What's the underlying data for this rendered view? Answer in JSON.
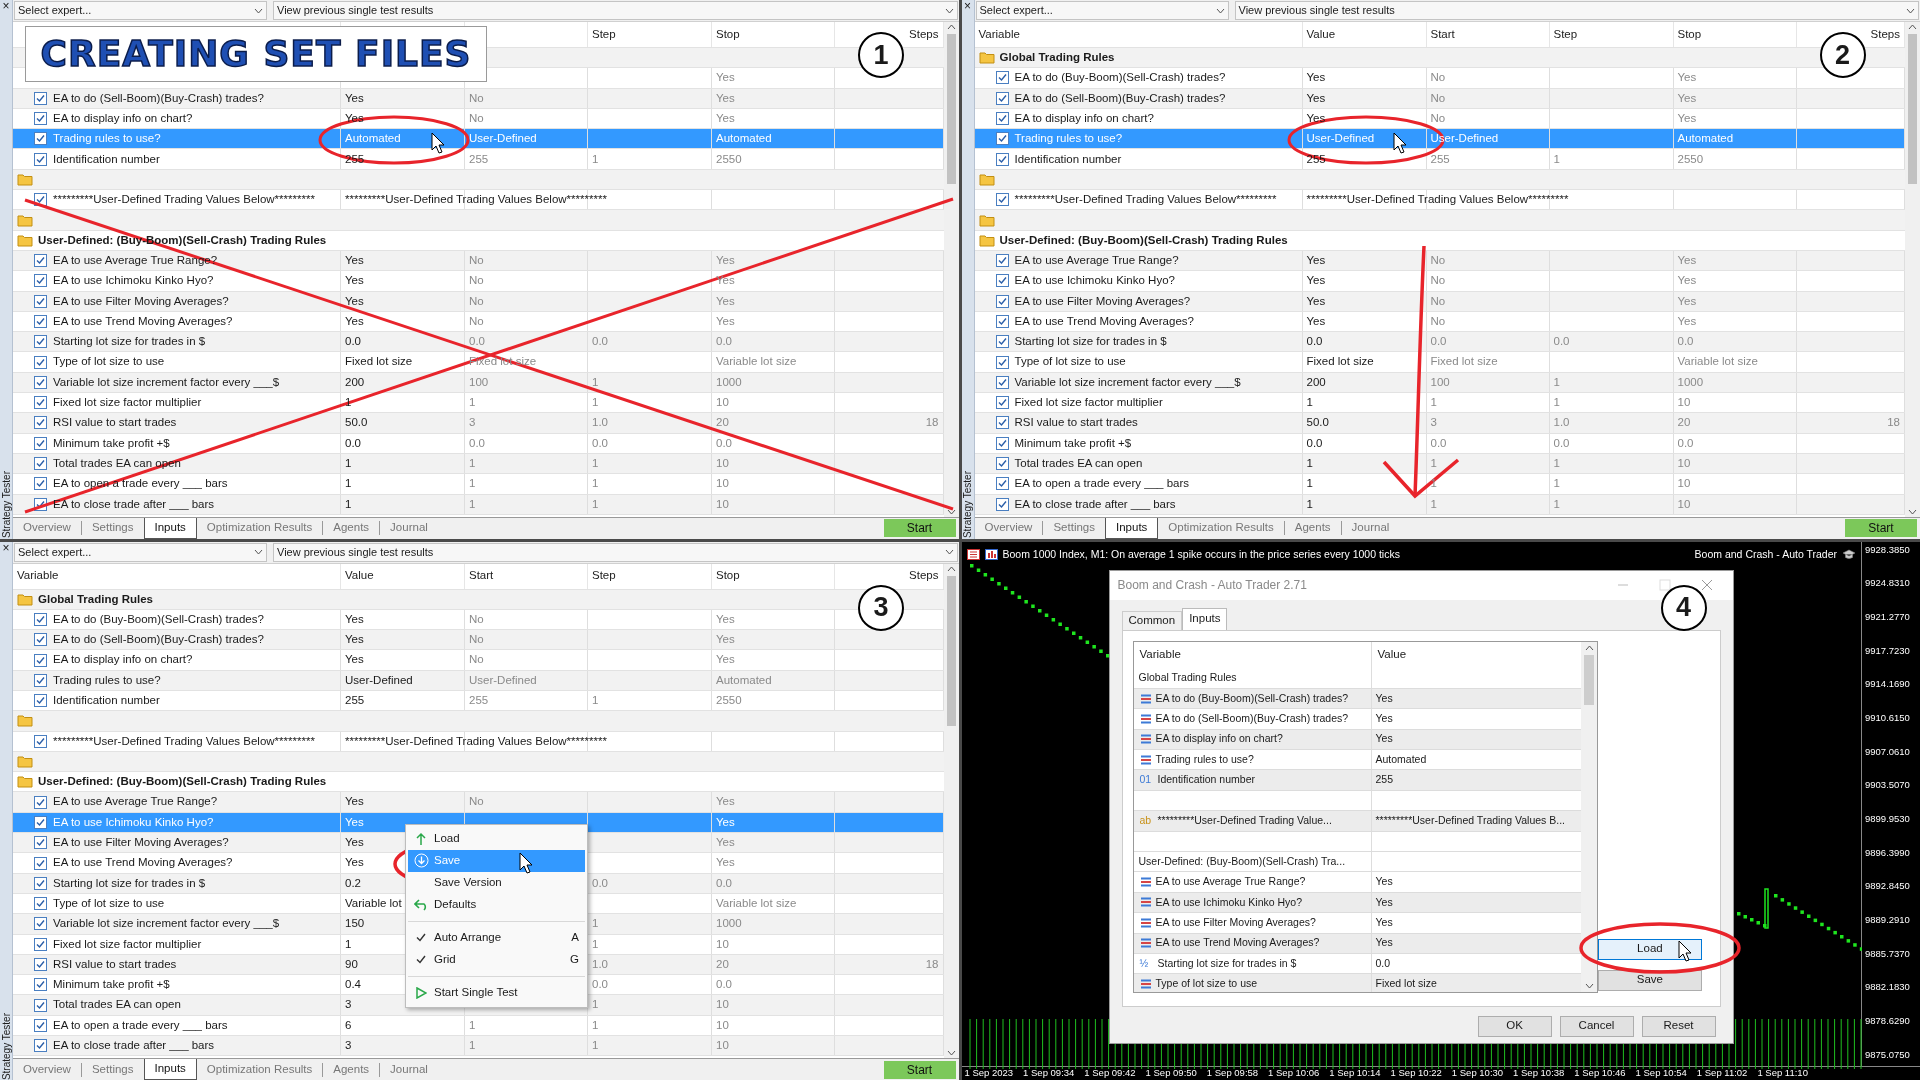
{
  "testers": [
    {
      "badge": "1",
      "banner": "CREATING SET FILES",
      "side": {
        "close": "×",
        "label": "Strategy Tester"
      },
      "toolbar": {
        "expert": "Select expert...",
        "results": "View previous single test results"
      },
      "header": {
        "step": "Step",
        "stop": "Stop",
        "steps": "Steps"
      },
      "rows": [
        {
          "kind": "group"
        },
        {
          "kind": "param",
          "selected": false,
          "stop": "Yes"
        },
        {
          "kind": "param",
          "checked": true,
          "selected": false,
          "variable": "EA to do (Sell-Boom)(Buy-Crash) trades?",
          "value": "Yes",
          "start": "No",
          "stop": "Yes"
        },
        {
          "kind": "param",
          "checked": true,
          "selected": false,
          "variable": "EA to display info on chart?",
          "value": "Yes",
          "start": "No",
          "stop": "Yes"
        },
        {
          "kind": "param",
          "checked": true,
          "selected": true,
          "variable": "Trading rules to use?",
          "value": "Automated",
          "start": "User-Defined",
          "stop": "Automated"
        },
        {
          "kind": "param",
          "checked": true,
          "selected": false,
          "variable": "Identification number",
          "value": "255",
          "start": "255",
          "step": "1",
          "stop": "2550"
        },
        {
          "kind": "folder"
        },
        {
          "kind": "param",
          "checked": true,
          "selected": false,
          "variable": "*********User-Defined Trading Values Below*********",
          "value": "*********User-Defined Trading Values Below*********"
        },
        {
          "kind": "folder"
        },
        {
          "kind": "group",
          "label": "User-Defined: (Buy-Boom)(Sell-Crash) Trading Rules"
        },
        {
          "kind": "param",
          "checked": true,
          "selected": false,
          "variable": "EA to use Average True Range?",
          "value": "Yes",
          "start": "No",
          "stop": "Yes"
        },
        {
          "kind": "param",
          "checked": true,
          "selected": false,
          "variable": "EA to use Ichimoku Kinko Hyo?",
          "value": "Yes",
          "start": "No",
          "stop": "Yes"
        },
        {
          "kind": "param",
          "checked": true,
          "selected": false,
          "variable": "EA to use Filter Moving Averages?",
          "value": "Yes",
          "start": "No",
          "stop": "Yes"
        },
        {
          "kind": "param",
          "checked": true,
          "selected": false,
          "variable": "EA to use Trend Moving Averages?",
          "value": "Yes",
          "start": "No",
          "stop": "Yes"
        },
        {
          "kind": "param",
          "checked": true,
          "selected": false,
          "variable": "Starting lot size for trades in $",
          "value": "0.0",
          "start": "0.0",
          "step": "0.0",
          "stop": "0.0"
        },
        {
          "kind": "param",
          "checked": true,
          "selected": false,
          "variable": "Type of lot size to use",
          "value": "Fixed lot size",
          "start": "Fixed lot size",
          "stop": "Variable lot size"
        },
        {
          "kind": "param",
          "checked": true,
          "selected": false,
          "variable": "Variable lot size increment factor every ___$",
          "value": "200",
          "start": "100",
          "step": "1",
          "stop": "1000"
        },
        {
          "kind": "param",
          "checked": true,
          "selected": false,
          "variable": "Fixed lot size factor multiplier",
          "value": "1",
          "start": "1",
          "step": "1",
          "stop": "10"
        },
        {
          "kind": "param",
          "checked": true,
          "selected": false,
          "variable": "RSI value to start trades",
          "value": "50.0",
          "start": "3",
          "step": "1.0",
          "stop": "20",
          "steps": "18"
        },
        {
          "kind": "param",
          "checked": true,
          "selected": false,
          "variable": "Minimum take profit +$",
          "value": "0.0",
          "start": "0.0",
          "step": "0.0",
          "stop": "0.0"
        },
        {
          "kind": "param",
          "checked": true,
          "selected": false,
          "variable": "Total trades EA can open",
          "value": "1",
          "start": "1",
          "step": "1",
          "stop": "10"
        },
        {
          "kind": "param",
          "checked": true,
          "selected": false,
          "variable": "EA to open a trade every ___ bars",
          "value": "1",
          "start": "1",
          "step": "1",
          "stop": "10"
        },
        {
          "kind": "param",
          "checked": true,
          "selected": false,
          "variable": "EA to close trade after ___ bars",
          "value": "1",
          "start": "1",
          "step": "1",
          "stop": "10"
        }
      ],
      "tabs": [
        {
          "label": "Overview",
          "selected": false
        },
        {
          "label": "Settings",
          "selected": false
        },
        {
          "label": "Inputs",
          "selected": true
        },
        {
          "label": "Optimization Results",
          "selected": false
        },
        {
          "label": "Agents",
          "selected": false
        },
        {
          "label": "Journal",
          "selected": false
        }
      ],
      "start": "Start"
    },
    {
      "badge": "2",
      "side": {
        "close": "×",
        "label": "Strategy Tester"
      },
      "toolbar": {
        "expert": "Select expert...",
        "results": "View previous single test results"
      },
      "header": {
        "variable": "Variable",
        "value": "Value",
        "start": "Start",
        "step": "Step",
        "stop": "Stop",
        "steps": "Steps"
      },
      "rows": [
        {
          "kind": "group",
          "label": "Global Trading Rules"
        },
        {
          "kind": "param",
          "checked": true,
          "selected": false,
          "variable": "EA to do (Buy-Boom)(Sell-Crash) trades?",
          "value": "Yes",
          "start": "No",
          "stop": "Yes"
        },
        {
          "kind": "param",
          "checked": true,
          "selected": false,
          "variable": "EA to do (Sell-Boom)(Buy-Crash) trades?",
          "value": "Yes",
          "start": "No",
          "stop": "Yes"
        },
        {
          "kind": "param",
          "checked": true,
          "selected": false,
          "variable": "EA to display info on chart?",
          "value": "Yes",
          "start": "No",
          "stop": "Yes"
        },
        {
          "kind": "param",
          "checked": true,
          "selected": true,
          "variable": "Trading rules to use?",
          "value": "User-Defined",
          "start": "User-Defined",
          "stop": "Automated"
        },
        {
          "kind": "param",
          "checked": true,
          "selected": false,
          "variable": "Identification number",
          "value": "255",
          "start": "255",
          "step": "1",
          "stop": "2550"
        },
        {
          "kind": "folder"
        },
        {
          "kind": "param",
          "checked": true,
          "selected": false,
          "variable": "*********User-Defined Trading Values Below*********",
          "value": "*********User-Defined Trading Values Below*********"
        },
        {
          "kind": "folder"
        },
        {
          "kind": "group",
          "label": "User-Defined: (Buy-Boom)(Sell-Crash) Trading Rules"
        },
        {
          "kind": "param",
          "checked": true,
          "selected": false,
          "variable": "EA to use Average True Range?",
          "value": "Yes",
          "start": "No",
          "stop": "Yes"
        },
        {
          "kind": "param",
          "checked": true,
          "selected": false,
          "variable": "EA to use Ichimoku Kinko Hyo?",
          "value": "Yes",
          "start": "No",
          "stop": "Yes"
        },
        {
          "kind": "param",
          "checked": true,
          "selected": false,
          "variable": "EA to use Filter Moving Averages?",
          "value": "Yes",
          "start": "No",
          "stop": "Yes"
        },
        {
          "kind": "param",
          "checked": true,
          "selected": false,
          "variable": "EA to use Trend Moving Averages?",
          "value": "Yes",
          "start": "No",
          "stop": "Yes"
        },
        {
          "kind": "param",
          "checked": true,
          "selected": false,
          "variable": "Starting lot size for trades in $",
          "value": "0.0",
          "start": "0.0",
          "step": "0.0",
          "stop": "0.0"
        },
        {
          "kind": "param",
          "checked": true,
          "selected": false,
          "variable": "Type of lot size to use",
          "value": "Fixed lot size",
          "start": "Fixed lot size",
          "stop": "Variable lot size"
        },
        {
          "kind": "param",
          "checked": true,
          "selected": false,
          "variable": "Variable lot size increment factor every ___$",
          "value": "200",
          "start": "100",
          "step": "1",
          "stop": "1000"
        },
        {
          "kind": "param",
          "checked": true,
          "selected": false,
          "variable": "Fixed lot size factor multiplier",
          "value": "1",
          "start": "1",
          "step": "1",
          "stop": "10"
        },
        {
          "kind": "param",
          "checked": true,
          "selected": false,
          "variable": "RSI value to start trades",
          "value": "50.0",
          "start": "3",
          "step": "1.0",
          "stop": "20",
          "steps": "18"
        },
        {
          "kind": "param",
          "checked": true,
          "selected": false,
          "variable": "Minimum take profit +$",
          "value": "0.0",
          "start": "0.0",
          "step": "0.0",
          "stop": "0.0"
        },
        {
          "kind": "param",
          "checked": true,
          "selected": false,
          "variable": "Total trades EA can open",
          "value": "1",
          "start": "1",
          "step": "1",
          "stop": "10"
        },
        {
          "kind": "param",
          "checked": true,
          "selected": false,
          "variable": "EA to open a trade every ___ bars",
          "value": "1",
          "start": "1",
          "step": "1",
          "stop": "10"
        },
        {
          "kind": "param",
          "checked": true,
          "selected": false,
          "variable": "EA to close trade after ___ bars",
          "value": "1",
          "start": "1",
          "step": "1",
          "stop": "10"
        }
      ],
      "tabs": [
        {
          "label": "Overview",
          "selected": false
        },
        {
          "label": "Settings",
          "selected": false
        },
        {
          "label": "Inputs",
          "selected": true
        },
        {
          "label": "Optimization Results",
          "selected": false
        },
        {
          "label": "Agents",
          "selected": false
        },
        {
          "label": "Journal",
          "selected": false
        }
      ],
      "start": "Start"
    },
    {
      "badge": "3",
      "side": {
        "close": "×",
        "label": "Strategy Tester"
      },
      "toolbar": {
        "expert": "Select expert...",
        "results": "View previous single test results"
      },
      "header": {
        "variable": "Variable",
        "value": "Value",
        "start": "Start",
        "step": "Step",
        "stop": "Stop",
        "steps": "Steps"
      },
      "rows": [
        {
          "kind": "group",
          "label": "Global Trading Rules"
        },
        {
          "kind": "param",
          "checked": true,
          "selected": false,
          "variable": "EA to do (Buy-Boom)(Sell-Crash) trades?",
          "value": "Yes",
          "start": "No",
          "stop": "Yes"
        },
        {
          "kind": "param",
          "checked": true,
          "selected": false,
          "variable": "EA to do (Sell-Boom)(Buy-Crash) trades?",
          "value": "Yes",
          "start": "No",
          "stop": "Yes"
        },
        {
          "kind": "param",
          "checked": true,
          "selected": false,
          "variable": "EA to display info on chart?",
          "value": "Yes",
          "start": "No",
          "stop": "Yes"
        },
        {
          "kind": "param",
          "checked": true,
          "selected": false,
          "variable": "Trading rules to use?",
          "value": "User-Defined",
          "start": "User-Defined",
          "stop": "Automated"
        },
        {
          "kind": "param",
          "checked": true,
          "selected": false,
          "variable": "Identification number",
          "value": "255",
          "start": "255",
          "step": "1",
          "stop": "2550"
        },
        {
          "kind": "folder"
        },
        {
          "kind": "param",
          "checked": true,
          "selected": false,
          "variable": "*********User-Defined Trading Values Below*********",
          "value": "*********User-Defined Trading Values Below*********"
        },
        {
          "kind": "folder"
        },
        {
          "kind": "group",
          "label": "User-Defined: (Buy-Boom)(Sell-Crash) Trading Rules"
        },
        {
          "kind": "param",
          "checked": true,
          "selected": false,
          "variable": "EA to use Average True Range?",
          "value": "Yes",
          "start": "No",
          "stop": "Yes"
        },
        {
          "kind": "param",
          "checked": true,
          "selected": true,
          "variable": "EA to use Ichimoku Kinko Hyo?",
          "value": "Yes",
          "stop": "Yes"
        },
        {
          "kind": "param",
          "checked": true,
          "selected": false,
          "variable": "EA to use Filter Moving Averages?",
          "value": "Yes",
          "stop": "Yes"
        },
        {
          "kind": "param",
          "checked": true,
          "selected": false,
          "variable": "EA to use Trend Moving Averages?",
          "value": "Yes",
          "stop": "Yes"
        },
        {
          "kind": "param",
          "checked": true,
          "selected": false,
          "variable": "Starting lot size for trades in $",
          "value": "0.2",
          "step": "0.0",
          "stop": "0.0"
        },
        {
          "kind": "param",
          "checked": true,
          "selected": false,
          "variable": "Type of lot size to use",
          "value": "Variable lot",
          "stop": "Variable lot size"
        },
        {
          "kind": "param",
          "checked": true,
          "selected": false,
          "variable": "Variable lot size increment factor every ___$",
          "value": "150",
          "step": "1",
          "stop": "1000"
        },
        {
          "kind": "param",
          "checked": true,
          "selected": false,
          "variable": "Fixed lot size factor multiplier",
          "value": "1",
          "step": "1",
          "stop": "10"
        },
        {
          "kind": "param",
          "checked": true,
          "selected": false,
          "variable": "RSI value to start trades",
          "value": "90",
          "step": "1.0",
          "stop": "20",
          "steps": "18"
        },
        {
          "kind": "param",
          "checked": true,
          "selected": false,
          "variable": "Minimum take profit +$",
          "value": "0.4",
          "step": "0.0",
          "stop": "0.0"
        },
        {
          "kind": "param",
          "checked": true,
          "selected": false,
          "variable": "Total trades EA can open",
          "value": "3",
          "step": "1",
          "stop": "10"
        },
        {
          "kind": "param",
          "checked": true,
          "selected": false,
          "variable": "EA to open a trade every ___ bars",
          "value": "6",
          "start": "1",
          "step": "1",
          "stop": "10"
        },
        {
          "kind": "param",
          "checked": true,
          "selected": false,
          "variable": "EA to close trade after ___ bars",
          "value": "3",
          "start": "1",
          "step": "1",
          "stop": "10"
        }
      ],
      "context_menu": [
        {
          "kind": "load",
          "label": "Load",
          "selected": false
        },
        {
          "kind": "save",
          "label": "Save",
          "selected": true
        },
        {
          "kind": "plain",
          "label": "Save Version",
          "selected": false
        },
        {
          "kind": "defaults",
          "label": "Defaults",
          "selected": false
        },
        {
          "kind": "separator"
        },
        {
          "kind": "toggle",
          "label": "Auto Arrange",
          "shortcut": "A",
          "selected": false,
          "checked": true
        },
        {
          "kind": "toggle",
          "label": "Grid",
          "shortcut": "G",
          "selected": false,
          "checked": true
        },
        {
          "kind": "separator"
        },
        {
          "kind": "run",
          "label": "Start Single Test",
          "selected": false
        }
      ],
      "tabs": [
        {
          "label": "Overview",
          "selected": false
        },
        {
          "label": "Settings",
          "selected": false
        },
        {
          "label": "Inputs",
          "selected": true
        },
        {
          "label": "Optimization Results",
          "selected": false
        },
        {
          "label": "Agents",
          "selected": false
        },
        {
          "label": "Journal",
          "selected": false
        }
      ],
      "start": "Start"
    }
  ],
  "terminal": {
    "badge": "4",
    "chart_title": "Boom 1000 Index, M1:  On average 1 spike occurs in the price series every 1000 ticks",
    "expert_name": "Boom and Crash - Auto Trader",
    "price_labels": [
      "9928.3850",
      "9924.8310",
      "9921.2770",
      "9917.7230",
      "9914.1690",
      "9910.6150",
      "9907.0610",
      "9903.5070",
      "9899.9530",
      "9896.3990",
      "9892.8450",
      "9889.2910",
      "9885.7370",
      "9882.1830",
      "9878.6290",
      "9875.0750"
    ],
    "time_labels": [
      "1 Sep 2023",
      "1 Sep 09:34",
      "1 Sep 09:42",
      "1 Sep 09:50",
      "1 Sep 09:58",
      "1 Sep 10:06",
      "1 Sep 10:14",
      "1 Sep 10:22",
      "1 Sep 10:30",
      "1 Sep 10:38",
      "1 Sep 10:46",
      "1 Sep 10:54",
      "1 Sep 11:02",
      "1 Sep 11:10"
    ],
    "dialog": {
      "title": "Boom and Crash - Auto Trader 2.71",
      "tabs": [
        {
          "label": "Common",
          "selected": false
        },
        {
          "label": "Inputs",
          "selected": true
        }
      ],
      "columns": [
        "Variable",
        "Value"
      ],
      "rows": [
        {
          "kind": "group",
          "variable": "Global Trading Rules"
        },
        {
          "kind": "enum",
          "variable": "EA to do (Buy-Boom)(Sell-Crash) trades?",
          "value": "Yes"
        },
        {
          "kind": "enum",
          "variable": "EA to do (Sell-Boom)(Buy-Crash) trades?",
          "value": "Yes"
        },
        {
          "kind": "enum",
          "variable": "EA to display info on chart?",
          "value": "Yes"
        },
        {
          "kind": "enum",
          "variable": "Trading rules to use?",
          "value": "Automated"
        },
        {
          "kind": "integer",
          "icon_text": "01",
          "variable": "Identification number",
          "value": "255"
        },
        {
          "kind": "blank"
        },
        {
          "kind": "string",
          "icon_text": "ab",
          "variable": "*********User-Defined Trading Value...",
          "value": "*********User-Defined Trading Values B..."
        },
        {
          "kind": "blank"
        },
        {
          "kind": "group",
          "variable": "User-Defined: (Buy-Boom)(Sell-Crash) Tra..."
        },
        {
          "kind": "enum",
          "variable": "EA to use Average True Range?",
          "value": "Yes"
        },
        {
          "kind": "enum",
          "variable": "EA to use Ichimoku Kinko Hyo?",
          "value": "Yes"
        },
        {
          "kind": "enum",
          "variable": "EA to use Filter Moving Averages?",
          "value": "Yes"
        },
        {
          "kind": "enum",
          "variable": "EA to use Trend Moving Averages?",
          "value": "Yes"
        },
        {
          "kind": "double",
          "icon_text": "½",
          "variable": "Starting lot size for trades in $",
          "value": "0.0"
        },
        {
          "kind": "enum",
          "variable": "Type of lot size to use",
          "value": "Fixed lot size"
        }
      ],
      "side_buttons": [
        {
          "label": "Load",
          "selected": true
        },
        {
          "label": "Save",
          "selected": false
        }
      ],
      "buttons": [
        "OK",
        "Cancel",
        "Reset"
      ]
    }
  }
}
